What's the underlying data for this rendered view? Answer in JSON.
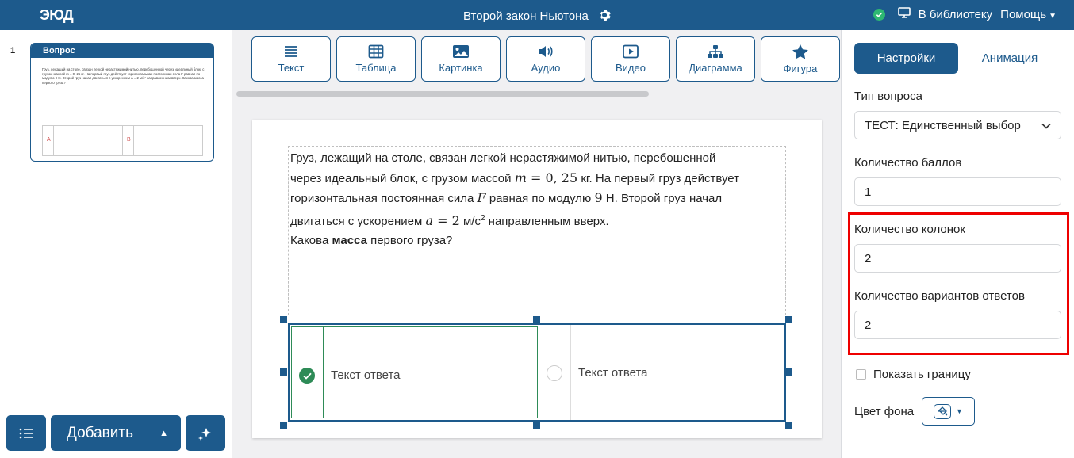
{
  "header": {
    "logo": "ЭЮД",
    "title": "Второй закон Ньютона",
    "library_link": "В библиотеку",
    "help_menu": "Помощь"
  },
  "slides": [
    {
      "number": "1",
      "title": "Вопрос",
      "preview_text": "Груз, лежащий на столе, связан легкой нерастяжимой нитью, перебошенной через идеальный блок, с грузом массой m = 0, 25 кг. На первый груз действует горизонтальная постоянная сила F равная по модулю 9 Н. Второй груз начал двигаться с ускорением a = 2 м/с² направленным вверх. Какова масса первого груза?",
      "answer_labels": [
        "A",
        "B"
      ]
    }
  ],
  "left_controls": {
    "add_label": "Добавить"
  },
  "toolbar": [
    {
      "label": "Текст",
      "icon": "text-lines-icon"
    },
    {
      "label": "Таблица",
      "icon": "table-icon"
    },
    {
      "label": "Картинка",
      "icon": "image-icon"
    },
    {
      "label": "Аудио",
      "icon": "speaker-icon"
    },
    {
      "label": "Видео",
      "icon": "play-icon"
    },
    {
      "label": "Диаграмма",
      "icon": "hierarchy-icon"
    },
    {
      "label": "Фигура",
      "icon": "star-icon"
    }
  ],
  "question": {
    "line1": "Груз, лежащий на столе, связан легкой нерастяжимой нитью, перебошенной",
    "line2_pre": "через идеальный блок, с грузом массой ",
    "line2_math_var": "m",
    "line2_math_eq": " = 0, 25",
    "line2_post": " кг. На первый груз действует",
    "line3_pre": "горизонтальная постоянная сила ",
    "line3_math_var": "F",
    "line3_mid": " равная по модулю ",
    "line3_num": "9",
    "line3_post": " Н. Второй груз начал",
    "line4_pre": "двигаться с ускорением ",
    "line4_math_var": "a",
    "line4_math_eq": " = 2",
    "line4_unit": " м/с",
    "line4_sup": "2",
    "line4_post": " направленным вверх.",
    "line5_pre": "Какова ",
    "line5_bold": "масса",
    "line5_post": " первого груза?"
  },
  "answers": [
    {
      "text": "Текст ответа",
      "correct": true
    },
    {
      "text": "Текст ответа",
      "correct": false
    }
  ],
  "settings": {
    "tab_settings": "Настройки",
    "tab_animation": "Анимация",
    "question_type_label": "Тип вопроса",
    "question_type_value": "ТЕСТ: Единственный выбор",
    "points_label": "Количество баллов",
    "points_value": "1",
    "columns_label": "Количество колонок",
    "columns_value": "2",
    "options_label": "Количество вариантов ответов",
    "options_value": "2",
    "show_border_label": "Показать границу",
    "bg_color_label": "Цвет фона"
  },
  "colors": {
    "primary": "#1d5a8c",
    "correct": "#2e8b57",
    "highlight": "#e00000",
    "status_ok": "#2eb872"
  }
}
